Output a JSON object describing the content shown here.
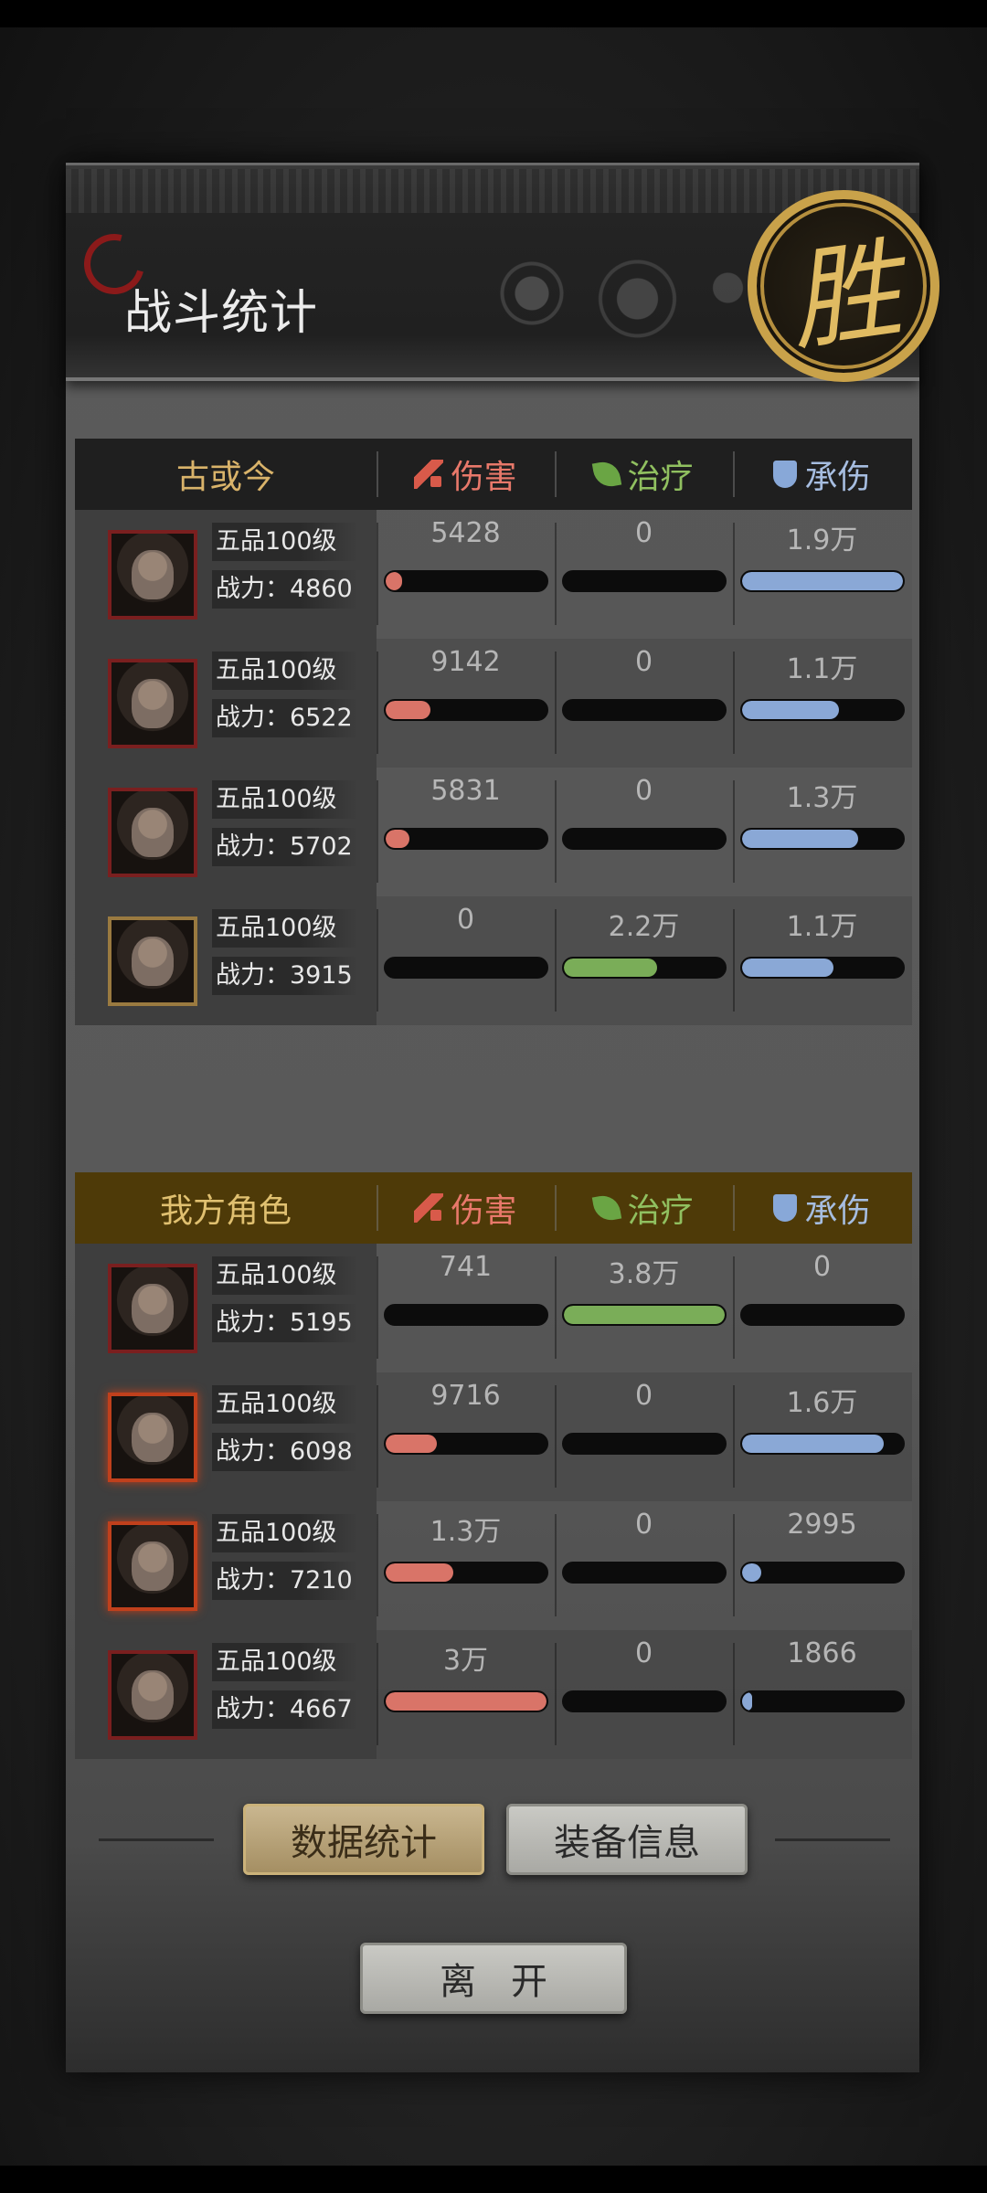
{
  "header": {
    "title": "战斗统计",
    "seal": "胜"
  },
  "columns": {
    "damage": "伤害",
    "heal": "治疗",
    "tank": "承伤"
  },
  "enemy": {
    "label": "古或今",
    "rows": [
      {
        "rank": "五品100级",
        "power": "战力：4860",
        "damage": "5428",
        "damage_pct": 0.1,
        "heal": "0",
        "heal_pct": 0,
        "tank": "1.9万",
        "tank_pct": 1.0
      },
      {
        "rank": "五品100级",
        "power": "战力：6522",
        "damage": "9142",
        "damage_pct": 0.28,
        "heal": "0",
        "heal_pct": 0,
        "tank": "1.1万",
        "tank_pct": 0.6
      },
      {
        "rank": "五品100级",
        "power": "战力：5702",
        "damage": "5831",
        "damage_pct": 0.15,
        "heal": "0",
        "heal_pct": 0,
        "tank": "1.3万",
        "tank_pct": 0.72
      },
      {
        "rank": "五品100级",
        "power": "战力：3915",
        "damage": "0",
        "damage_pct": 0,
        "heal": "2.2万",
        "heal_pct": 0.58,
        "tank": "1.1万",
        "tank_pct": 0.57
      }
    ]
  },
  "ally": {
    "label": "我方角色",
    "rows": [
      {
        "rank": "五品100级",
        "power": "战力：5195",
        "damage": "741",
        "damage_pct": 0,
        "heal": "3.8万",
        "heal_pct": 1.0,
        "tank": "0",
        "tank_pct": 0
      },
      {
        "rank": "五品100级",
        "power": "战力：6098",
        "damage": "9716",
        "damage_pct": 0.32,
        "heal": "0",
        "heal_pct": 0,
        "tank": "1.6万",
        "tank_pct": 0.88
      },
      {
        "rank": "五品100级",
        "power": "战力：7210",
        "damage": "1.3万",
        "damage_pct": 0.42,
        "heal": "0",
        "heal_pct": 0,
        "tank": "2995",
        "tank_pct": 0.12
      },
      {
        "rank": "五品100级",
        "power": "战力：4667",
        "damage": "3万",
        "damage_pct": 1.0,
        "heal": "0",
        "heal_pct": 0,
        "tank": "1866",
        "tank_pct": 0.06
      }
    ]
  },
  "tabs": {
    "stats": "数据统计",
    "equipment": "装备信息"
  },
  "leave_label": "离开"
}
